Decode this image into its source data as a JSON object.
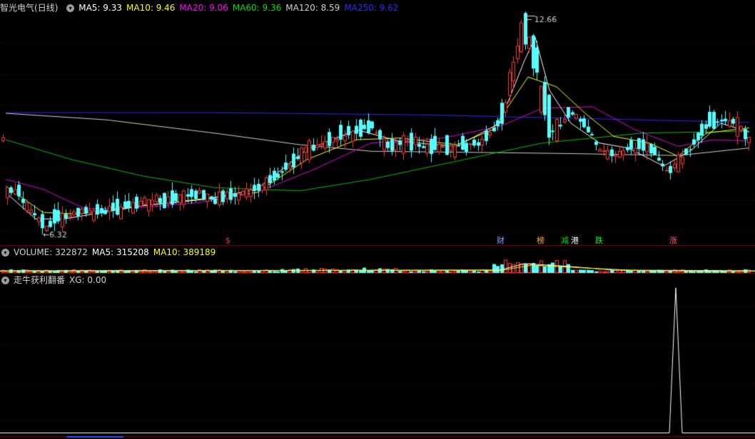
{
  "main": {
    "stock_name": "智光电气",
    "period": "(日线)",
    "ma_labels": [
      {
        "text": "MA5: 9.33",
        "color": "#ffffff"
      },
      {
        "text": "MA10: 9.46",
        "color": "#ffff00"
      },
      {
        "text": "MA20: 9.06",
        "color": "#ff00ff"
      },
      {
        "text": "MA60: 9.36",
        "color": "#00e000"
      },
      {
        "text": "MA120: 8.59",
        "color": "#d0d0d0"
      },
      {
        "text": "MA250: 9.62",
        "color": "#2a2aff"
      }
    ],
    "high_label": "12.66",
    "low_label": "6.32",
    "up_color": "#ff3c3c",
    "down_color": "#54ffff"
  },
  "markers": [
    {
      "text": "$",
      "color": "#ff3030"
    },
    {
      "text": "财",
      "color": "#7aa8ff"
    },
    {
      "text": "榜",
      "color": "#ffb000"
    },
    {
      "text": "减",
      "color": "#00e000"
    },
    {
      "text": "港",
      "color": "#ffffff"
    },
    {
      "text": "跌",
      "color": "#00ff00"
    },
    {
      "text": "涨",
      "color": "#ff6060"
    }
  ],
  "volume": {
    "label": "VOLUME: 322872",
    "ma5": "MA5: 315208",
    "ma10": "MA10: 389189"
  },
  "indicator": {
    "name": "走牛获利翻番",
    "xg": "XG: 0.00"
  }
}
